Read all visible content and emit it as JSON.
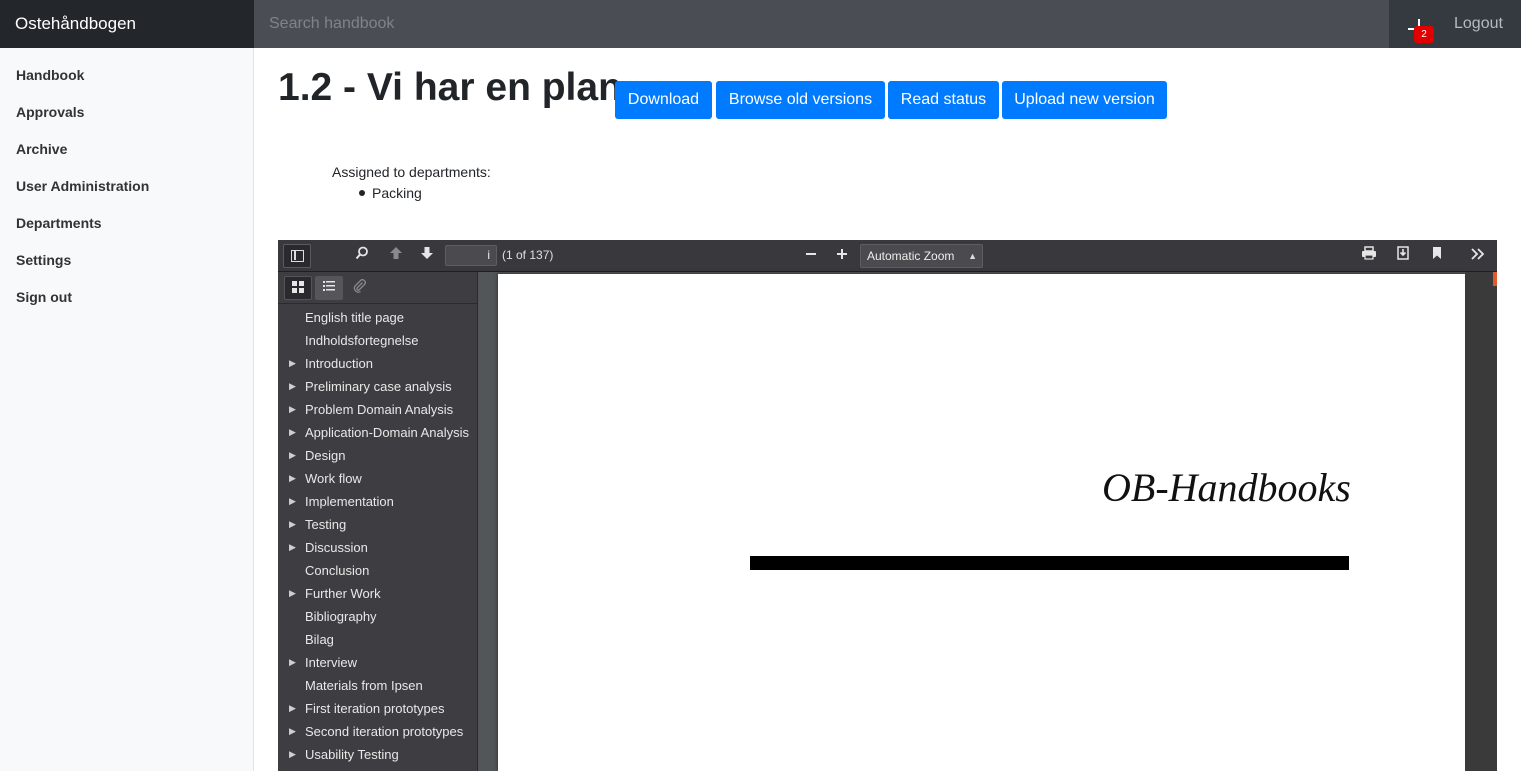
{
  "navbar": {
    "brand": "Ostehåndbogen",
    "search_placeholder": "Search handbook",
    "notification_count": "2",
    "logout_label": "Logout"
  },
  "sidebar": {
    "items": [
      {
        "label": "Handbook"
      },
      {
        "label": "Approvals"
      },
      {
        "label": "Archive"
      },
      {
        "label": "User Administration"
      },
      {
        "label": "Departments"
      },
      {
        "label": "Settings"
      },
      {
        "label": "Sign out"
      }
    ]
  },
  "document": {
    "title": "1.2 - Vi har en plan",
    "buttons": {
      "download": "Download",
      "browse": "Browse old versions",
      "read_status": "Read status",
      "upload": "Upload new version"
    },
    "assigned_label": "Assigned to departments:",
    "departments": [
      "Packing"
    ]
  },
  "pdf_viewer": {
    "page_input": "i",
    "page_count": "(1 of 137)",
    "zoom": "Automatic Zoom",
    "outline": [
      {
        "label": "English title page",
        "expandable": false
      },
      {
        "label": "Indholdsfortegnelse",
        "expandable": false
      },
      {
        "label": "Introduction",
        "expandable": true
      },
      {
        "label": "Preliminary case analysis",
        "expandable": true
      },
      {
        "label": "Problem Domain Analysis",
        "expandable": true
      },
      {
        "label": "Application-Domain Analysis",
        "expandable": true
      },
      {
        "label": "Design",
        "expandable": true
      },
      {
        "label": "Work flow",
        "expandable": true
      },
      {
        "label": "Implementation",
        "expandable": true
      },
      {
        "label": "Testing",
        "expandable": true
      },
      {
        "label": "Discussion",
        "expandable": true
      },
      {
        "label": "Conclusion",
        "expandable": false
      },
      {
        "label": "Further Work",
        "expandable": true
      },
      {
        "label": "Bibliography",
        "expandable": false
      },
      {
        "label": "Bilag",
        "expandable": false
      },
      {
        "label": "Interview",
        "expandable": true
      },
      {
        "label": "Materials from Ipsen",
        "expandable": false
      },
      {
        "label": "First iteration prototypes",
        "expandable": true
      },
      {
        "label": "Second iteration prototypes",
        "expandable": true
      },
      {
        "label": "Usability Testing",
        "expandable": true
      }
    ],
    "page_heading": "OB-Handbooks"
  },
  "colors": {
    "primary_button": "#007bff",
    "navbar": "#343a40",
    "badge": "#e00000"
  }
}
